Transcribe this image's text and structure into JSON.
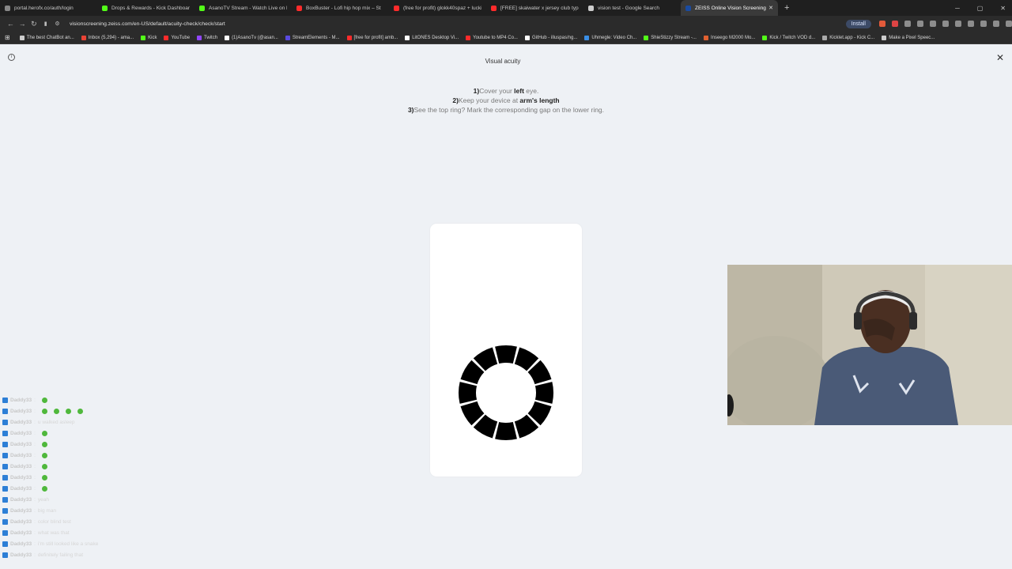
{
  "browser": {
    "tabs": [
      {
        "title": "portal.herofx.co/auth/login",
        "color": "#888888",
        "active": false
      },
      {
        "title": "Drops & Rewards - Kick Dashboard",
        "color": "#53fc18",
        "active": false
      },
      {
        "title": "AsanoTV Stream - Watch Live on Kick",
        "color": "#53fc18",
        "active": false
      },
      {
        "title": "BoxBuster - Lofi hip hop mix – St",
        "color": "#ff2b2b",
        "active": false
      },
      {
        "title": "(free for profit) glokk40spaz + lucki",
        "color": "#ff2b2b",
        "active": false
      },
      {
        "title": "[FREE] skaiwater x jersey club type be",
        "color": "#ff2b2b",
        "active": false
      },
      {
        "title": "vision test - Google Search",
        "color": "#cccccc",
        "active": false
      },
      {
        "title": "ZEISS Online Vision Screening",
        "color": "#1a4ba0",
        "active": true
      }
    ],
    "url": "visionscreening.zeiss.com/en-US/default/acuity-check/check/start",
    "install_label": "Install",
    "bookmarks": [
      {
        "label": "The best ChatBot an...",
        "color": "#cccccc"
      },
      {
        "label": "Inbox (5,294) - ama...",
        "color": "#ea4335"
      },
      {
        "label": "Kick",
        "color": "#53fc18"
      },
      {
        "label": "YouTube",
        "color": "#ff2b2b"
      },
      {
        "label": "Twitch",
        "color": "#9146ff"
      },
      {
        "label": "(1)AsanoTv (@asan...",
        "color": "#ffffff"
      },
      {
        "label": "StreamElements - M...",
        "color": "#5a4ae0"
      },
      {
        "label": "[free for profit] amb...",
        "color": "#ff2b2b"
      },
      {
        "label": "LitONES Desktop Vi...",
        "color": "#ffffff"
      },
      {
        "label": "Youtube to MP4 Co...",
        "color": "#ff2b2b"
      },
      {
        "label": "GitHub - illuspas/ng...",
        "color": "#ffffff"
      },
      {
        "label": "Uhmegle: Video Ch...",
        "color": "#3a8ee6"
      },
      {
        "label": "ShieStizzy Stream -...",
        "color": "#53fc18"
      },
      {
        "label": "Inseego M2000 Mo...",
        "color": "#e06030"
      },
      {
        "label": "Kick / Twitch VOD d...",
        "color": "#53fc18"
      },
      {
        "label": "Kicklet.app - Kick C...",
        "color": "#aaaaaa"
      },
      {
        "label": "Make a Pixel Speec...",
        "color": "#cccccc"
      }
    ]
  },
  "page": {
    "title": "Visual acuity",
    "instructions": [
      {
        "num": "1)",
        "pre": "Cover your ",
        "bold": "left",
        "post": " eye."
      },
      {
        "num": "2)",
        "pre": "Keep your device at ",
        "bold": "arm's length",
        "post": ""
      },
      {
        "num": "3)",
        "pre": "See the top ring? Mark the corresponding gap on the lower ring.",
        "bold": "",
        "post": ""
      }
    ],
    "ring": {
      "segments": 12,
      "color": "#000000"
    }
  },
  "chat": {
    "lines": [
      {
        "user": "Daddy33",
        "msg": "",
        "emotes": 1
      },
      {
        "user": "Daddy33",
        "msg": "",
        "emotes": 4
      },
      {
        "user": "Daddy33",
        "msg": "u walked asleep",
        "emotes": 0
      },
      {
        "user": "Daddy33",
        "msg": "",
        "emotes": 1
      },
      {
        "user": "Daddy33",
        "msg": "",
        "emotes": 1
      },
      {
        "user": "Daddy33",
        "msg": "",
        "emotes": 1
      },
      {
        "user": "Daddy33",
        "msg": "",
        "emotes": 1
      },
      {
        "user": "Daddy33",
        "msg": "",
        "emotes": 1
      },
      {
        "user": "Daddy33",
        "msg": "",
        "emotes": 1
      },
      {
        "user": "Daddy33",
        "msg": "yeah",
        "emotes": 0
      },
      {
        "user": "Daddy33",
        "msg": "big man",
        "emotes": 0
      },
      {
        "user": "Daddy33",
        "msg": "color blind test",
        "emotes": 0
      },
      {
        "user": "Daddy33",
        "msg": "what was that",
        "emotes": 0
      },
      {
        "user": "Daddy33",
        "msg": "i'm still looked like a snake",
        "emotes": 0
      },
      {
        "user": "Daddy33",
        "msg": "definitely failing that",
        "emotes": 0
      }
    ]
  }
}
